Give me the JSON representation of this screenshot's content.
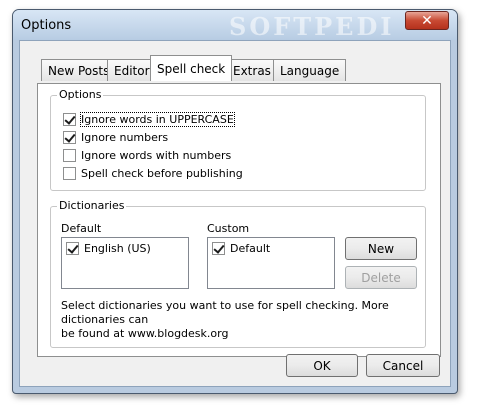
{
  "window": {
    "title": "Options",
    "watermark": "SOFTPEDI",
    "close_glyph": "✕"
  },
  "tabs": [
    {
      "label": "New Posts",
      "active": false
    },
    {
      "label": "Editor",
      "active": false
    },
    {
      "label": "Spell check",
      "active": true
    },
    {
      "label": "Extras",
      "active": false
    },
    {
      "label": "Language",
      "active": false
    }
  ],
  "options_group": {
    "title": "Options",
    "items": [
      {
        "label": "Ignore words in UPPERCASE",
        "checked": true
      },
      {
        "label": "Ignore numbers",
        "checked": true
      },
      {
        "label": "Ignore words with numbers",
        "checked": false
      },
      {
        "label": "Spell check before publishing",
        "checked": false
      }
    ]
  },
  "dictionaries_group": {
    "title": "Dictionaries",
    "default_label": "Default",
    "custom_label": "Custom",
    "default_items": [
      {
        "label": "English (US)",
        "checked": true
      }
    ],
    "custom_items": [
      {
        "label": "Default",
        "checked": true
      }
    ],
    "new_button": "New",
    "delete_button": "Delete",
    "hint_line1": "Select dictionaries you want to use for spell checking. More dictionaries can",
    "hint_line2": "be found at www.blogdesk.org"
  },
  "footer": {
    "ok_button": "OK",
    "cancel_button": "Cancel"
  }
}
